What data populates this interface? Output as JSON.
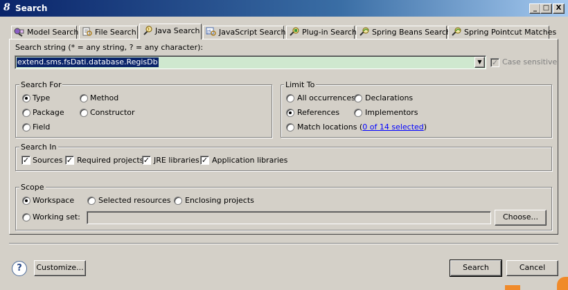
{
  "window": {
    "title": "Search",
    "controls": {
      "minimize": "_",
      "maximize": "□",
      "close": "X"
    }
  },
  "tabs": [
    {
      "label": "Model Search",
      "icon": "model-search-icon"
    },
    {
      "label": "File Search",
      "icon": "file-search-icon"
    },
    {
      "label": "Java Search",
      "icon": "java-search-icon",
      "active": true
    },
    {
      "label": "JavaScript Search",
      "icon": "javascript-search-icon"
    },
    {
      "label": "Plug-in Search",
      "icon": "plugin-search-icon"
    },
    {
      "label": "Spring Beans Search",
      "icon": "spring-beans-icon"
    },
    {
      "label": "Spring Pointcut Matches",
      "icon": "spring-pointcut-icon"
    }
  ],
  "search_string": {
    "label": "Search string (* = any string, ? = any character):",
    "value": "extend.sms.fsDati.database.RegisDb",
    "case_sensitive": {
      "label": "Case sensitive",
      "checked": true,
      "enabled": false
    }
  },
  "search_for": {
    "title": "Search For",
    "options": [
      {
        "label": "Type",
        "selected": true
      },
      {
        "label": "Method",
        "selected": false
      },
      {
        "label": "Package",
        "selected": false
      },
      {
        "label": "Constructor",
        "selected": false
      },
      {
        "label": "Field",
        "selected": false
      }
    ]
  },
  "limit_to": {
    "title": "Limit To",
    "options": [
      {
        "label": "All occurrences",
        "selected": false
      },
      {
        "label": "Declarations",
        "selected": false
      },
      {
        "label": "References",
        "selected": true
      },
      {
        "label": "Implementors",
        "selected": false
      },
      {
        "label": "Match locations (",
        "selected": false
      }
    ],
    "match_link": "0 of 14 selected",
    "match_suffix": ")"
  },
  "search_in": {
    "title": "Search In",
    "options": [
      {
        "label": "Sources",
        "checked": true
      },
      {
        "label": "Required projects",
        "checked": true
      },
      {
        "label": "JRE libraries",
        "checked": true
      },
      {
        "label": "Application libraries",
        "checked": true
      }
    ]
  },
  "scope": {
    "title": "Scope",
    "options": [
      {
        "label": "Workspace",
        "selected": true
      },
      {
        "label": "Selected resources",
        "selected": false
      },
      {
        "label": "Enclosing projects",
        "selected": false
      },
      {
        "label": "Working set:",
        "selected": false
      }
    ],
    "working_set_value": "",
    "choose_label": "Choose..."
  },
  "footer": {
    "help_icon": "help-icon",
    "help_glyph": "?",
    "customize_label": "Customize...",
    "search_label": "Search",
    "cancel_label": "Cancel"
  },
  "colors": {
    "dialog_bg": "#d4d0c8",
    "titlebar_start": "#0a246a",
    "titlebar_end": "#a6caf0",
    "selection_bg": "#0a246a",
    "input_highlight": "#cfe8cf",
    "link": "#0000ff"
  }
}
